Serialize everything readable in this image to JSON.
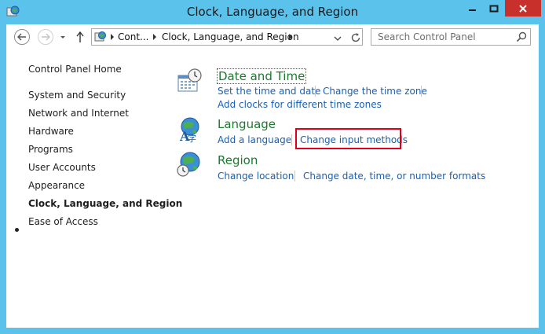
{
  "window": {
    "title": "Clock, Language, and Region"
  },
  "address": {
    "crumbs": [
      "Cont...",
      "Clock, Language, and Region"
    ],
    "search_placeholder": "Search Control Panel"
  },
  "sidebar": {
    "home": "Control Panel Home",
    "items": [
      {
        "label": "System and Security",
        "active": false
      },
      {
        "label": "Network and Internet",
        "active": false
      },
      {
        "label": "Hardware",
        "active": false
      },
      {
        "label": "Programs",
        "active": false
      },
      {
        "label": "User Accounts",
        "active": false
      },
      {
        "label": "Appearance",
        "active": false
      },
      {
        "label": "Clock, Language, and Region",
        "active": true
      },
      {
        "label": "Ease of Access",
        "active": false
      }
    ]
  },
  "categories": [
    {
      "title": "Date and Time",
      "icon": "clock-calendar-icon",
      "links": [
        "Set the time and date",
        "Change the time zone",
        "Add clocks for different time zones"
      ]
    },
    {
      "title": "Language",
      "icon": "language-globe-icon",
      "links": [
        "Add a language",
        "Change input methods"
      ]
    },
    {
      "title": "Region",
      "icon": "region-globe-icon",
      "links": [
        "Change location",
        "Change date, time, or number formats"
      ]
    }
  ],
  "colors": {
    "window_frame": "#5bc2ec",
    "category_title": "#1b7a2e",
    "link": "#1a5fb4",
    "highlight_box": "#e0001b",
    "close_button": "#c7302b"
  }
}
